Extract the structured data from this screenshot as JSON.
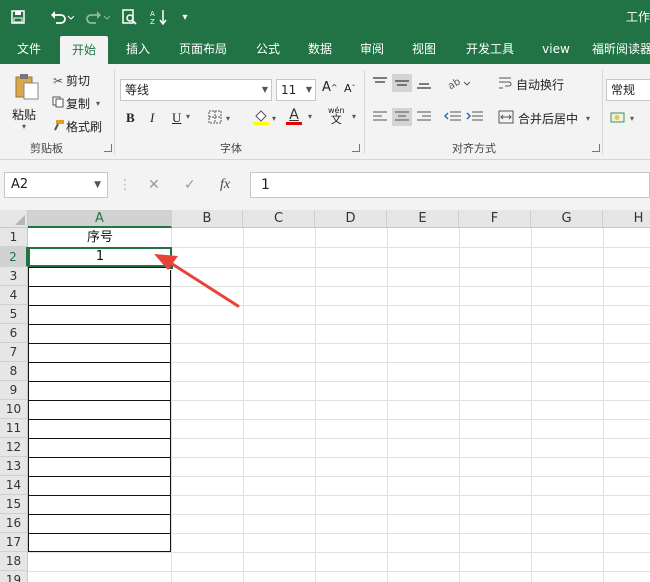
{
  "titlebar": {
    "save_icon": "save-icon",
    "undo_icon": "undo-icon",
    "redo_icon": "redo-icon",
    "print_preview_icon": "print-preview-icon",
    "sort_icon": "sort-ascending-icon",
    "customize_icon": "customize-toolbar-icon",
    "title": "工作"
  },
  "tabs": [
    "文件",
    "开始",
    "插入",
    "页面布局",
    "公式",
    "数据",
    "审阅",
    "视图",
    "开发工具",
    "view",
    "福昕阅读器"
  ],
  "active_tab": "开始",
  "ribbon": {
    "clipboard": {
      "paste_label": "粘贴",
      "cut_label": "剪切",
      "copy_label": "复制",
      "format_painter_label": "格式刷",
      "group_label": "剪贴板"
    },
    "font": {
      "font_name": "等线",
      "font_size": "11",
      "bold": "B",
      "italic": "I",
      "underline": "U",
      "font_color_glyph": "A",
      "phonetic": "wén",
      "group_label": "字体"
    },
    "alignment": {
      "wrap_text_label": "自动换行",
      "merge_center_label": "合并后居中",
      "group_label": "对齐方式"
    },
    "number": {
      "format_value": "常规"
    }
  },
  "formula_bar": {
    "name_box": "A2",
    "cancel": "✕",
    "enter": "✓",
    "fx": "fx",
    "value": "1"
  },
  "grid": {
    "columns": [
      "A",
      "B",
      "C",
      "D",
      "E",
      "F",
      "G",
      "H"
    ],
    "rows": [
      "1",
      "2",
      "3",
      "4",
      "5",
      "6",
      "7",
      "8",
      "9",
      "10",
      "11",
      "12",
      "13",
      "14",
      "15",
      "16",
      "17",
      "18",
      "19"
    ],
    "selected_cell": "A2",
    "cells": {
      "A1": "序号",
      "A2": "1"
    }
  },
  "annotation": {
    "arrow_color": "#e8433b",
    "points_to": "A2"
  },
  "colors": {
    "excel_green": "#217346",
    "ribbon_bg": "#f3f3f3",
    "font_color_bar": "#e60000"
  }
}
